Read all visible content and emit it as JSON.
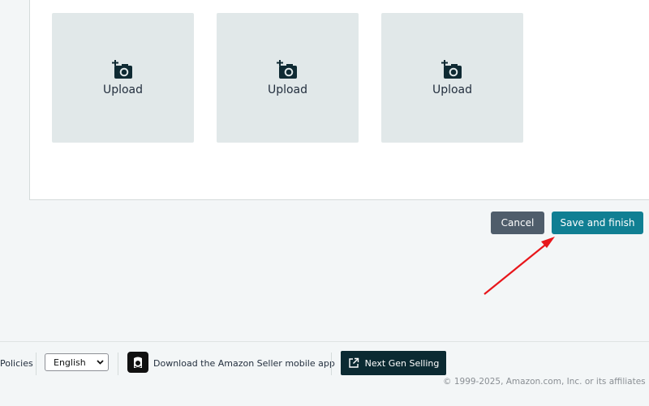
{
  "uploads": [
    {
      "label": "Upload",
      "icon": "add-photo-icon"
    },
    {
      "label": "Upload",
      "icon": "add-photo-icon"
    },
    {
      "label": "Upload",
      "icon": "add-photo-icon"
    }
  ],
  "actions": {
    "cancel_label": "Cancel",
    "save_label": "Save and finish"
  },
  "footer": {
    "policies_label": "Policies",
    "language_selected": "English",
    "app_download_label": "Download the Amazon Seller mobile app",
    "next_gen_label": "Next Gen Selling",
    "copyright": "© 1999-2025, Amazon.com, Inc. or its affiliates"
  },
  "colors": {
    "primary_button": "#107f93",
    "secondary_button": "#4f5d6b",
    "tile_background": "#e1e8e9",
    "annotation_arrow": "#e8161b"
  }
}
